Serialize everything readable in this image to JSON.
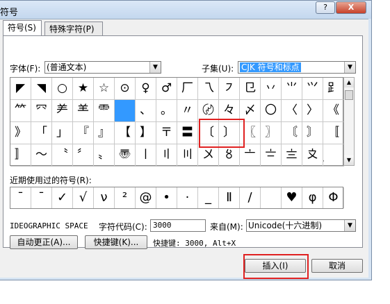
{
  "window": {
    "title": "符号",
    "help_label": "?",
    "close_label": "X"
  },
  "tabs": [
    {
      "label": "符号(S)"
    },
    {
      "label": "特殊字符(P)"
    }
  ],
  "font": {
    "label": "字体(F):",
    "value": "(普通文本)"
  },
  "subset": {
    "label": "子集(U):",
    "value": "CJK 符号和标点"
  },
  "symbols": [
    [
      "◤",
      "◥",
      "○",
      "★",
      "☆",
      "⊙",
      "♀",
      "♂",
      "厂",
      "乁",
      "㇇",
      "㔾",
      "丷",
      "⺌",
      "⺍",
      "⻊"
    ],
    [
      "⺮",
      "⺳",
      "⺶",
      "⺷",
      "⻗",
      "",
      "、",
      "。",
      "〃",
      "〄",
      "々",
      "〆",
      "〇",
      "〈",
      "〉",
      "《"
    ],
    [
      "》",
      "「",
      "」",
      "『",
      "』",
      "【",
      "】",
      "〒",
      "〓",
      "〔",
      "〕",
      "〖",
      "〗",
      "〘",
      "〙",
      "〚"
    ],
    [
      "〛",
      "〜",
      "〝",
      "〞",
      "〟",
      "〠",
      "〡",
      "〢",
      "〣",
      "〤",
      "〥",
      "〦",
      "〧",
      "〨",
      "〩",
      "〪"
    ]
  ],
  "recent": {
    "label": "近期使用过的符号(R):",
    "symbols": [
      "¯",
      "ˉ",
      "✓",
      "√",
      "ν",
      "²",
      "@",
      "•",
      "·",
      "_",
      "Ⅱ",
      "/",
      "",
      "♥",
      "φ",
      "Φ"
    ]
  },
  "char_name": "IDEOGRAPHIC SPACE",
  "char_code": {
    "label": "字符代码(C):",
    "value": "3000"
  },
  "from": {
    "label": "来自(M):",
    "value": "Unicode(十六进制)"
  },
  "autocorrect_label": "自动更正(A)...",
  "shortcut_key_label": "快捷键(K)...",
  "shortcut_text": "快捷键: 3000, Alt+X",
  "insert_label": "插入(I)",
  "cancel_label": "取消"
}
